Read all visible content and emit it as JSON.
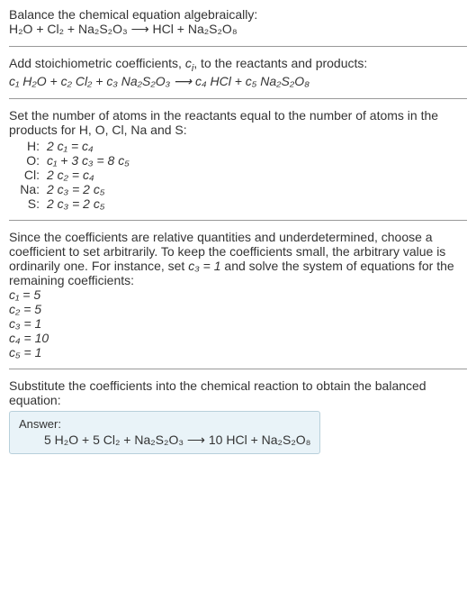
{
  "intro": {
    "line1": "Balance the chemical equation algebraically:",
    "eq": "H₂O + Cl₂ + Na₂S₂O₃ ⟶ HCl + Na₂S₂O₈"
  },
  "stoich": {
    "line1_a": "Add stoichiometric coefficients, ",
    "line1_ci": "c",
    "line1_ci_sub": "i",
    "line1_b": ", to the reactants and products:",
    "eq_plain": "c₁ H₂O + c₂ Cl₂ + c₃ Na₂S₂O₃ ⟶ c₄ HCl + c₅ Na₂S₂O₈"
  },
  "atoms": {
    "intro": "Set the number of atoms in the reactants equal to the number of atoms in the products for H, O, Cl, Na and S:",
    "rows": [
      {
        "el": "H:",
        "expr": "2 c₁ = c₄"
      },
      {
        "el": "O:",
        "expr": "c₁ + 3 c₃ = 8 c₅"
      },
      {
        "el": "Cl:",
        "expr": "2 c₂ = c₄"
      },
      {
        "el": "Na:",
        "expr": "2 c₃ = 2 c₅"
      },
      {
        "el": "S:",
        "expr": "2 c₃ = 2 c₅"
      }
    ]
  },
  "solve": {
    "intro_a": "Since the coefficients are relative quantities and underdetermined, choose a coefficient to set arbitrarily. To keep the coefficients small, the arbitrary value is ordinarily one. For instance, set ",
    "c3eq": "c₃ = 1",
    "intro_b": " and solve the system of equations for the remaining coefficients:",
    "lines": [
      "c₁ = 5",
      "c₂ = 5",
      "c₃ = 1",
      "c₄ = 10",
      "c₅ = 1"
    ]
  },
  "final": {
    "intro": "Substitute the coefficients into the chemical reaction to obtain the balanced equation:",
    "answer_label": "Answer:",
    "answer_eq": "5 H₂O + 5 Cl₂ + Na₂S₂O₃ ⟶ 10 HCl + Na₂S₂O₈"
  }
}
